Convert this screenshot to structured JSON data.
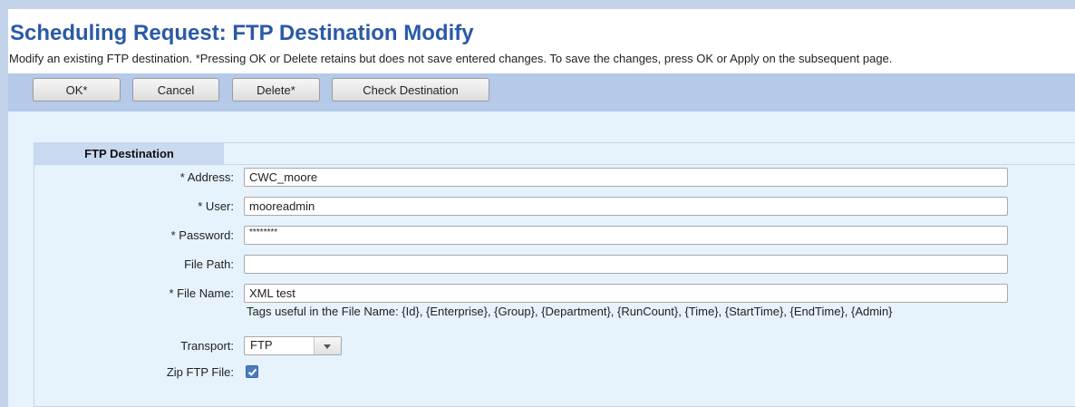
{
  "header": {
    "title": "Scheduling Request: FTP Destination Modify",
    "subtitle": "Modify an existing FTP destination. *Pressing OK or Delete retains but does not save entered changes. To save the changes, press OK or Apply on the subsequent page."
  },
  "toolbar": {
    "ok_label": "OK*",
    "cancel_label": "Cancel",
    "delete_label": "Delete*",
    "check_label": "Check Destination"
  },
  "panel": {
    "tab_label": "FTP Destination"
  },
  "form": {
    "address": {
      "label": "* Address:",
      "value": "CWC_moore"
    },
    "user": {
      "label": "* User:",
      "value": "mooreadmin"
    },
    "password": {
      "label": "* Password:",
      "value": "********"
    },
    "file_path": {
      "label": "File Path:",
      "value": ""
    },
    "file_name": {
      "label": "* File Name:",
      "value": "XML test"
    },
    "tags_hint": "Tags useful in the File Name:  {Id}, {Enterprise}, {Group}, {Department}, {RunCount}, {Time}, {StartTime}, {EndTime}, {Admin}",
    "transport": {
      "label": "Transport:",
      "selected": "FTP"
    },
    "zip": {
      "label": "Zip FTP File:",
      "checked": true
    }
  },
  "colors": {
    "title": "#2a5aa5",
    "toolbar_bg": "#b5c9e8",
    "content_bg": "#e6f2fc",
    "checkbox": "#4a7cc0"
  }
}
